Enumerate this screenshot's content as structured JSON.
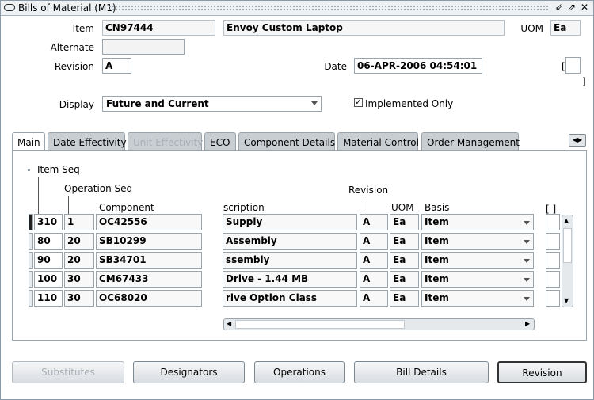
{
  "window": {
    "title": "Bills of Material (M1)"
  },
  "header": {
    "item_label": "Item",
    "item_value": "CN97444",
    "item_desc": "Envoy Custom Laptop",
    "uom_label": "UOM",
    "uom_value": "Ea",
    "alternate_label": "Alternate",
    "alternate_value": "",
    "revision_label": "Revision",
    "revision_value": "A",
    "date_label": "Date",
    "date_value": "06-APR-2006 04:54:01",
    "display_label": "Display",
    "display_value": "Future and Current",
    "implemented_label": "Implemented Only",
    "implemented_checked": true
  },
  "tabs": [
    {
      "label": "Main",
      "active": true
    },
    {
      "label": "Date Effectivity"
    },
    {
      "label": "Unit Effectivity",
      "disabled": true
    },
    {
      "label": "ECO"
    },
    {
      "label": "Component Details"
    },
    {
      "label": "Material Control"
    },
    {
      "label": "Order Management"
    }
  ],
  "grid": {
    "headers": {
      "item_seq": "Item Seq",
      "op_seq": "Operation Seq",
      "component": "Component",
      "description": "scription",
      "revision": "Revision",
      "uom": "UOM",
      "basis": "Basis",
      "flex": "[ ]"
    },
    "rows": [
      {
        "item_seq": "310",
        "op_seq": "1",
        "component": "OC42556",
        "description": "Supply",
        "revision": "A",
        "uom": "Ea",
        "basis": "Item"
      },
      {
        "item_seq": "80",
        "op_seq": "20",
        "component": "SB10299",
        "description": "Assembly",
        "revision": "A",
        "uom": "Ea",
        "basis": "Item"
      },
      {
        "item_seq": "90",
        "op_seq": "20",
        "component": "SB34701",
        "description": "ssembly",
        "revision": "A",
        "uom": "Ea",
        "basis": "Item"
      },
      {
        "item_seq": "100",
        "op_seq": "30",
        "component": "CM67433",
        "description": "Drive - 1.44 MB",
        "revision": "A",
        "uom": "Ea",
        "basis": "Item"
      },
      {
        "item_seq": "110",
        "op_seq": "30",
        "component": "OC68020",
        "description": "rive Option Class",
        "revision": "A",
        "uom": "Ea",
        "basis": "Item"
      }
    ]
  },
  "buttons": {
    "substitutes": "Substitutes",
    "designators": "Designators",
    "operations": "Operations",
    "bill_details": "Bill Details",
    "revision": "Revision"
  },
  "colors": {
    "tab_bg": "#c9ced3",
    "panel_border": "#9aa4ad"
  }
}
